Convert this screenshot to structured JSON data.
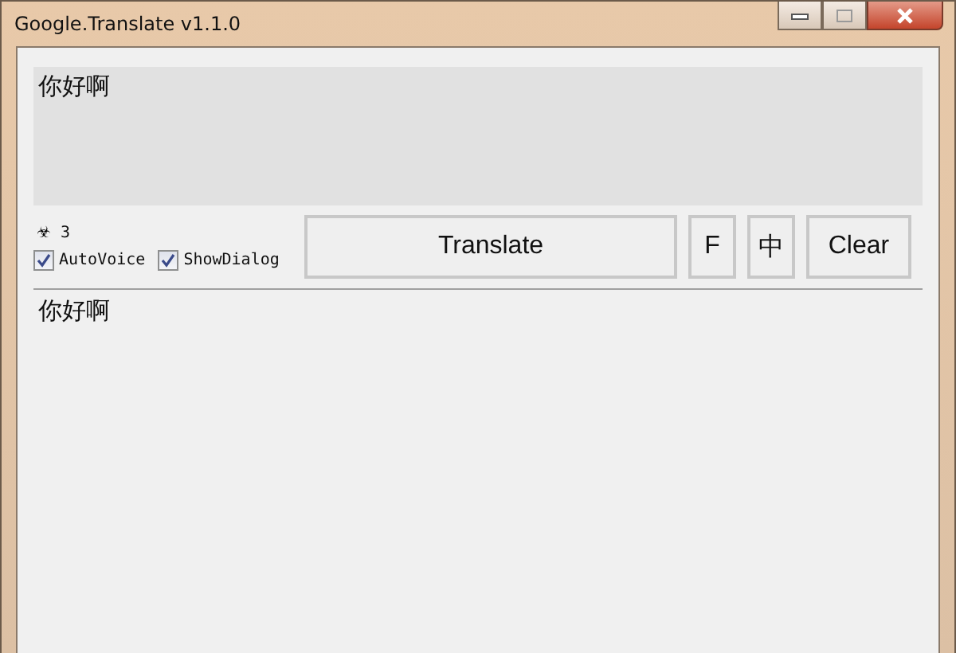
{
  "window": {
    "title": "Google.Translate v1.1.0"
  },
  "input": {
    "value": "你好啊"
  },
  "counter": {
    "icon": "☣",
    "count": "3"
  },
  "checkboxes": [
    {
      "label": "AutoVoice",
      "checked": true
    },
    {
      "label": "ShowDialog",
      "checked": true
    }
  ],
  "buttons": [
    {
      "label": "Translate",
      "kind": "wide"
    },
    {
      "label": "F",
      "kind": "narrow"
    },
    {
      "label": "中",
      "kind": "narrow"
    },
    {
      "label": "Clear",
      "kind": "normal"
    }
  ],
  "output": {
    "text": "你好啊"
  }
}
